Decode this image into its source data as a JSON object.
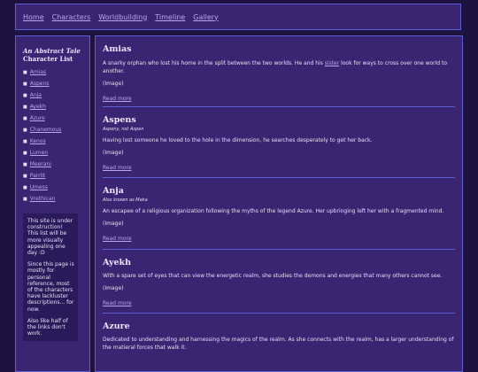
{
  "nav": {
    "home": "Home",
    "characters": "Characters",
    "worldbuilding": "Worldbuilding",
    "timeline": "Timeline",
    "gallery": "Gallery"
  },
  "sidebar": {
    "title_italic": "An Abstract Tale",
    "title_sub": "Character List",
    "items": [
      "Amias",
      "Aspens",
      "Anja",
      "Ayekh",
      "Azure",
      "Chanemous",
      "Kenos",
      "Lumen",
      "Meerani",
      "Parrlit",
      "Umess",
      "Vrethican"
    ],
    "notice": [
      "This site is under construction! This list will be more visually appealing one day :D",
      "Since this page is mostly for personal reference, most of the characters have lackluster descriptions... for now.",
      "Also like half of the links don't work."
    ]
  },
  "entries": [
    {
      "name": "Amias",
      "aka": "",
      "desc_before": "A snarky orphan who lost his home in the split between the two worlds. He and his ",
      "desc_link": "sister",
      "desc_after": " look for ways to cross over one world to another.",
      "image": "(Image)",
      "more": "Read more"
    },
    {
      "name": "Aspens",
      "aka": "Aspeny, not Aspen",
      "desc_before": "Having lost someone he loved to the hole in the dimension, he searches desperately to get her back.",
      "desc_link": "",
      "desc_after": "",
      "image": "(Image)",
      "more": "Read more"
    },
    {
      "name": "Anja",
      "aka": "Also known as Maka",
      "desc_before": "An escapee of a religious organization following the myths of the legend Azure. Her upbringing left her with a fragmented mind.",
      "desc_link": "",
      "desc_after": "",
      "image": "(Image)",
      "more": "Read more"
    },
    {
      "name": "Ayekh",
      "aka": "",
      "desc_before": "With a spare set of eyes that can view the energetic realm, she studies the demons and energies that many others cannot see.",
      "desc_link": "",
      "desc_after": "",
      "image": "(Image)",
      "more": "Read more"
    },
    {
      "name": "Azure",
      "aka": "",
      "desc_before": "Dedicated to understanding and harnessing the magics of the realm. As she connects with the realm, has a larger understanding of the matieral forces that walk it.",
      "desc_link": "",
      "desc_after": "",
      "image": "",
      "more": ""
    }
  ]
}
